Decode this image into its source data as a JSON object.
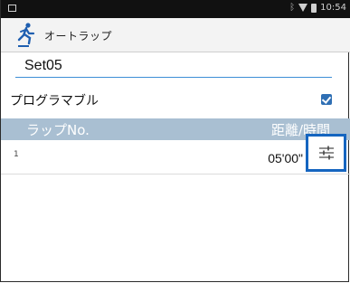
{
  "status_bar": {
    "time": "10:54",
    "icons": [
      "notification-icon",
      "bluetooth-icon",
      "wifi-icon",
      "battery-icon"
    ]
  },
  "app_bar": {
    "title": "オートラップ",
    "icon": "runner-icon"
  },
  "name_field": {
    "value": "Set05"
  },
  "programmable": {
    "label": "プログラマブル",
    "checked": true
  },
  "table": {
    "headers": {
      "lap": "ラップNo.",
      "distance_time": "距離/時間"
    },
    "rows": [
      {
        "index": "1",
        "value": "05'00\""
      }
    ]
  },
  "colors": {
    "accent": "#3d8ed6",
    "header_bg": "#a9bfd2",
    "highlight": "#1565c0"
  }
}
